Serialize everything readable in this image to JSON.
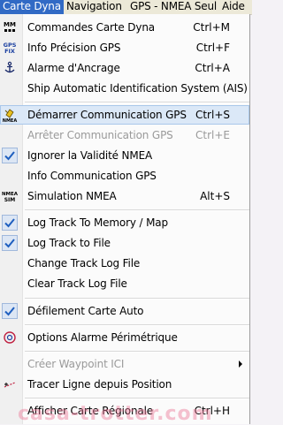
{
  "menubar": {
    "items": [
      {
        "label": "Carte Dyna",
        "active": true
      },
      {
        "label": "Navigation",
        "active": false
      },
      {
        "label": "GPS - NMEA Seul",
        "active": false
      },
      {
        "label": "Aide",
        "active": false
      }
    ]
  },
  "menu": {
    "items": [
      {
        "label": "Commandes Carte Dyna",
        "shortcut": "Ctrl+M",
        "icon": "mm-icon",
        "icon_text": "MM"
      },
      {
        "label": "Info Précision GPS",
        "shortcut": "Ctrl+F",
        "icon": "gps-fix-icon",
        "icon_text": "GPS FIX"
      },
      {
        "label": "Alarme d'Ancrage",
        "shortcut": "Ctrl+A",
        "icon": "anchor-icon"
      },
      {
        "label": "Ship Automatic Identification System (AIS)",
        "shortcut": ""
      },
      {
        "label": "Démarrer Communication GPS",
        "shortcut": "Ctrl+S",
        "icon": "nmea-satellite-icon",
        "icon_text": "NMEA",
        "state": "hover"
      },
      {
        "label": "Arrêter Communication GPS",
        "shortcut": "Ctrl+E",
        "state": "disabled"
      },
      {
        "label": "Ignorer la Validité NMEA",
        "shortcut": "",
        "checked": true
      },
      {
        "label": "Info Communication GPS",
        "shortcut": ""
      },
      {
        "label": "Simulation NMEA",
        "shortcut": "Alt+S",
        "icon": "nmea-sim-icon",
        "icon_text": "NMEA SIM"
      },
      {
        "label": "Log Track To Memory / Map",
        "shortcut": "",
        "checked": true
      },
      {
        "label": "Log Track to File",
        "shortcut": "",
        "checked": true
      },
      {
        "label": "Change Track Log File",
        "shortcut": ""
      },
      {
        "label": "Clear Track Log File",
        "shortcut": ""
      },
      {
        "label": "Défilement Carte Auto",
        "shortcut": "",
        "checked": true
      },
      {
        "label": "Options Alarme Périmétrique",
        "shortcut": "",
        "icon": "perimeter-alarm-icon"
      },
      {
        "label": "Créer Waypoint ICI",
        "shortcut": "",
        "state": "disabled",
        "submenu": true
      },
      {
        "label": "Tracer Ligne depuis Position",
        "shortcut": "",
        "icon": "draw-line-icon"
      },
      {
        "label": "Afficher Carte Régionale",
        "shortcut": "Ctrl+H"
      }
    ]
  },
  "watermark": "casa-trotter.com",
  "colors": {
    "accent": "#316ac5",
    "check": "#1f5fbf",
    "hover_bg": "#dbe8f7",
    "disabled_text": "#9a9a9a"
  }
}
